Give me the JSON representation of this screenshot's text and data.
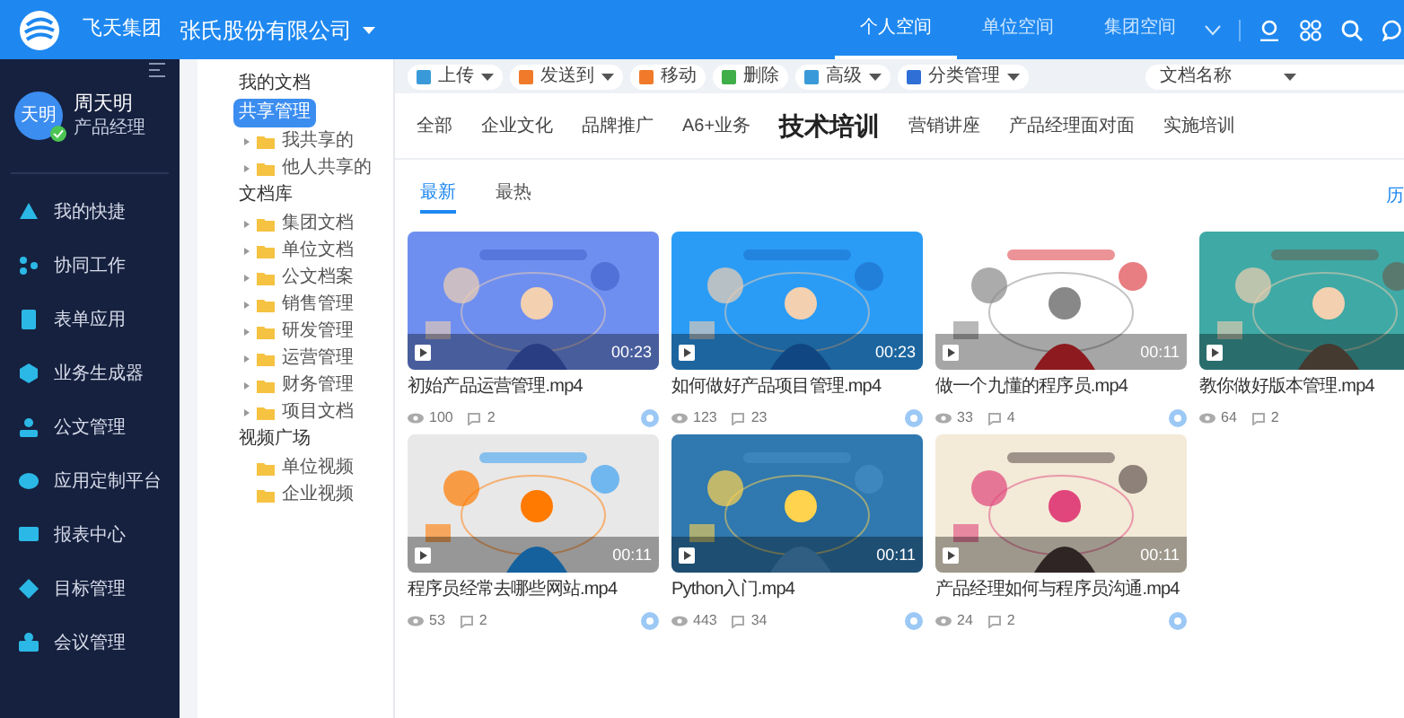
{
  "header": {
    "org": "飞天集团",
    "company": "张氏股份有限公司",
    "nav_tabs": [
      {
        "label": "个人空间",
        "selected": true
      },
      {
        "label": "单位空间",
        "selected": false
      },
      {
        "label": "集团空间",
        "selected": false
      }
    ]
  },
  "sidebar": {
    "user": {
      "avatar_text": "天明",
      "name": "周天明",
      "role": "产品经理",
      "verified": true
    },
    "items": [
      {
        "label": "我的快捷"
      },
      {
        "label": "协同工作"
      },
      {
        "label": "表单应用"
      },
      {
        "label": "业务生成器"
      },
      {
        "label": "公文管理"
      },
      {
        "label": "应用定制平台"
      },
      {
        "label": "报表中心"
      },
      {
        "label": "目标管理"
      },
      {
        "label": "会议管理"
      }
    ]
  },
  "tree": [
    {
      "label": "我的文档",
      "selected": false
    },
    {
      "label": "共享管理",
      "selected": true,
      "children": [
        {
          "label": "我共享的",
          "expandable": true,
          "selected": false
        },
        {
          "label": "他人共享的",
          "expandable": true,
          "selected": false
        }
      ]
    },
    {
      "label": "文档库",
      "selected": false,
      "children": [
        {
          "label": "集团文档",
          "expandable": true,
          "selected": false
        },
        {
          "label": "单位文档",
          "expandable": true,
          "selected": false
        },
        {
          "label": "公文档案",
          "expandable": true,
          "selected": false
        },
        {
          "label": "销售管理",
          "expandable": true,
          "selected": false
        },
        {
          "label": "研发管理",
          "expandable": true,
          "selected": false
        },
        {
          "label": "运营管理",
          "expandable": true,
          "selected": false
        },
        {
          "label": "财务管理",
          "expandable": true,
          "selected": false
        },
        {
          "label": "项目文档",
          "expandable": true,
          "selected": false
        }
      ]
    },
    {
      "label": "视频广场",
      "selected": false,
      "children": [
        {
          "label": "单位视频",
          "expandable": false,
          "selected": false
        },
        {
          "label": "企业视频",
          "expandable": false,
          "selected": false
        }
      ]
    }
  ],
  "toolbar": {
    "buttons": [
      {
        "label": "上传",
        "dropdown": true
      },
      {
        "label": "发送到",
        "dropdown": true
      },
      {
        "label": "移动",
        "dropdown": false
      },
      {
        "label": "删除",
        "dropdown": false
      },
      {
        "label": "高级",
        "dropdown": true
      },
      {
        "label": "分类管理",
        "dropdown": true
      }
    ],
    "search_select": {
      "value": "文档名称"
    }
  },
  "categories": [
    {
      "label": "全部",
      "selected": false
    },
    {
      "label": "企业文化",
      "selected": false
    },
    {
      "label": "品牌推广",
      "selected": false
    },
    {
      "label": "A6+业务",
      "selected": false
    },
    {
      "label": "技术培训",
      "selected": true
    },
    {
      "label": "营销讲座",
      "selected": false
    },
    {
      "label": "产品经理面对面",
      "selected": false
    },
    {
      "label": "实施培训",
      "selected": false
    }
  ],
  "sort_tabs": [
    {
      "label": "最新",
      "selected": true
    },
    {
      "label": "最热",
      "selected": false
    }
  ],
  "history_link": "历",
  "videos": [
    {
      "title": "初始产品运营管理.mp4",
      "duration": "00:23",
      "views": "100",
      "comments": "2",
      "settings": true
    },
    {
      "title": "如何做好产品项目管理.mp4",
      "duration": "00:23",
      "views": "123",
      "comments": "23",
      "settings": true
    },
    {
      "title": "做一个九懂的程序员.mp4",
      "duration": "00:11",
      "views": "33",
      "comments": "4",
      "settings": true
    },
    {
      "title": "教你做好版本管理.mp4",
      "views": "64",
      "comments": "2"
    },
    {
      "title": "程序员经常去哪些网站.mp4",
      "duration": "00:11",
      "views": "53",
      "comments": "2",
      "settings": true
    },
    {
      "title": "Python入门.mp4",
      "duration": "00:11",
      "views": "443",
      "comments": "34",
      "settings": true
    },
    {
      "title": "产品经理如何与程序员沟通.mp4",
      "duration": "00:11",
      "views": "24",
      "comments": "2",
      "settings": true
    }
  ]
}
